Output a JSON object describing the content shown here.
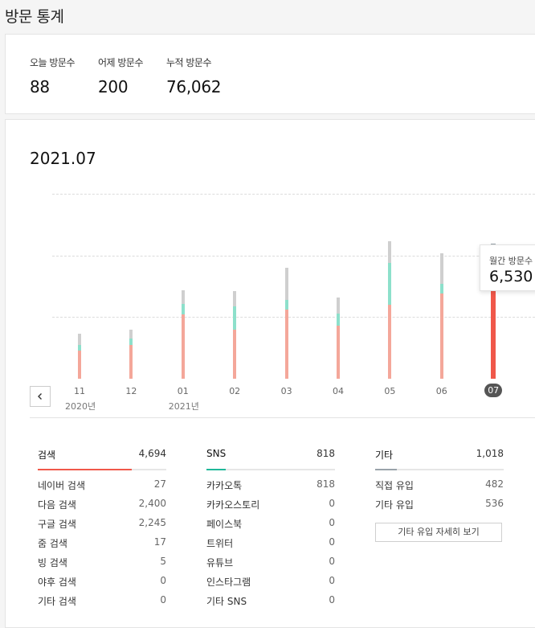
{
  "page_title": "방문 통계",
  "summary": {
    "today": {
      "label": "오늘 방문수",
      "value": "88"
    },
    "yesterday": {
      "label": "어제 방문수",
      "value": "200"
    },
    "total": {
      "label": "누적 방문수",
      "value": "76,062"
    }
  },
  "period": "2021.07",
  "tooltip": {
    "label": "월간 방문수",
    "value": "6,530"
  },
  "icons": {
    "prev": "chevron-left-icon"
  },
  "chart_data": {
    "type": "bar",
    "stacked": true,
    "categories": [
      "11",
      "12",
      "01",
      "02",
      "03",
      "04",
      "05",
      "06",
      "07"
    ],
    "year_labels": [
      {
        "at": "11",
        "text": "2020년"
      },
      {
        "at": "01",
        "text": "2021년"
      }
    ],
    "active_category": "07",
    "series": [
      {
        "color": "#f4a79a",
        "active_color": "#f0584a",
        "values": [
          1850,
          2200,
          4150,
          3200,
          4500,
          3450,
          4800,
          5550,
          6400
        ]
      },
      {
        "color": "#8de0cb",
        "active_color": "#20b89a",
        "values": [
          350,
          400,
          700,
          1500,
          600,
          800,
          2700,
          600,
          1050
        ]
      },
      {
        "color": "#cfcfcf",
        "active_color": "#9aa3aa",
        "values": [
          700,
          600,
          900,
          1000,
          2100,
          1000,
          1400,
          2000,
          1300
        ]
      }
    ],
    "ylim": [
      0,
      12000
    ],
    "grid": true
  },
  "breakdown": [
    {
      "name": "검색",
      "total": "4,694",
      "color": "#f0584a",
      "fill_ratio": 0.73,
      "rows": [
        {
          "label": "네이버 검색",
          "value": "27"
        },
        {
          "label": "다음 검색",
          "value": "2,400"
        },
        {
          "label": "구글 검색",
          "value": "2,245"
        },
        {
          "label": "줌 검색",
          "value": "17"
        },
        {
          "label": "빙 검색",
          "value": "5"
        },
        {
          "label": "야후 검색",
          "value": "0"
        },
        {
          "label": "기타 검색",
          "value": "0"
        }
      ]
    },
    {
      "name": "SNS",
      "total": "818",
      "color": "#20b89a",
      "fill_ratio": 0.15,
      "rows": [
        {
          "label": "카카오톡",
          "value": "818"
        },
        {
          "label": "카카오스토리",
          "value": "0"
        },
        {
          "label": "페이스북",
          "value": "0"
        },
        {
          "label": "트위터",
          "value": "0"
        },
        {
          "label": "유튜브",
          "value": "0"
        },
        {
          "label": "인스타그램",
          "value": "0"
        },
        {
          "label": "기타 SNS",
          "value": "0"
        }
      ]
    },
    {
      "name": "기타",
      "total": "1,018",
      "color": "#9aa3aa",
      "fill_ratio": 0.17,
      "rows": [
        {
          "label": "직접 유입",
          "value": "482"
        },
        {
          "label": "기타 유입",
          "value": "536"
        }
      ],
      "button": "기타 유입 자세히 보기"
    }
  ]
}
